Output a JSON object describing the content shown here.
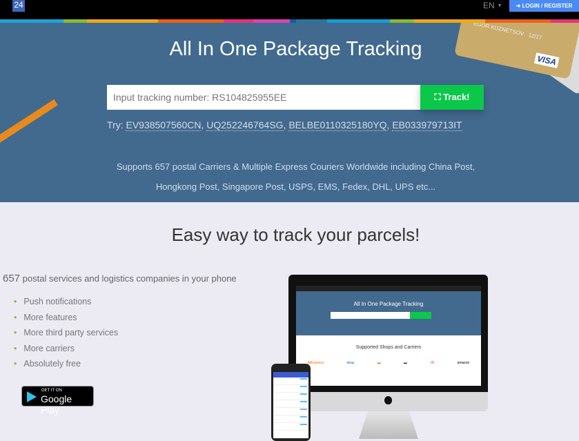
{
  "topbar": {
    "logo": "24",
    "language": "EN",
    "login_label": "LOGIN / REGISTER",
    "login_color": "#4a8af4"
  },
  "stripe_colors": [
    "#1aa5d8",
    "#8cba2c",
    "#f0a810",
    "#f06010",
    "#e8307c",
    "#e040b0",
    "#0a5ea8",
    "#25779c",
    "#10a0d8",
    "#8cba2c",
    "#f0a810",
    "#f06010",
    "#e8307c"
  ],
  "hero": {
    "title": "All In One Package Tracking",
    "search_placeholder": "Input tracking number: RS104825955EE",
    "track_label": "Track!",
    "try_label": "Try:",
    "examples": [
      "EV938507560CN",
      "UQ252246764SG",
      "BELBE0110325180YQ",
      "EB033979713IT"
    ],
    "support_line1": "Supports 657 postal Carriers & Multiple Express Couriers Worldwide including China Post,",
    "support_line2": "Hongkong Post, Singapore Post, USPS, EMS, Fedex, DHL, UPS etc...",
    "card_name": "EGOR KUZNETSOV",
    "card_expiry": "12/17",
    "card_brand": "VISA",
    "bg_color": "#426a8e",
    "accent_color": "#0cc84a"
  },
  "app": {
    "heading": "Easy way to track your parcels!",
    "count": "657",
    "count_text": "postal services and logistics companies in your phone",
    "features": [
      "Push notifications",
      "More features",
      "More third party services",
      "More carriers",
      "Absolutely free"
    ],
    "gplay_small": "GET IT ON",
    "gplay_big": "Google Play"
  },
  "mockup": {
    "title": "All In One Package Tracking",
    "shops": "Supported Shops and Carriers",
    "logos": [
      "AliExpress",
      "ebay",
      "",
      "",
      "JD",
      "amazon"
    ]
  }
}
